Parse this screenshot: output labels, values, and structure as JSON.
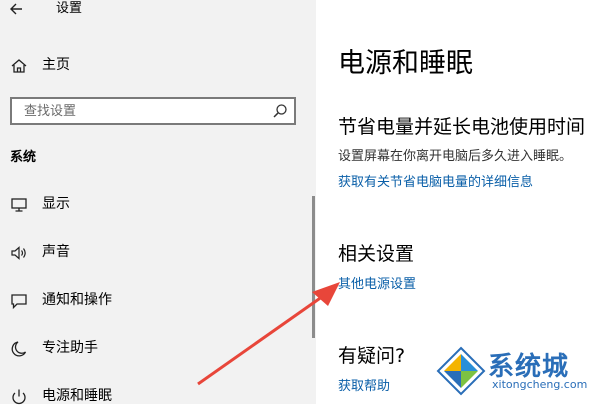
{
  "window": {
    "title": "设置"
  },
  "sidebar": {
    "home_label": "主页",
    "search_placeholder": "查找设置",
    "section_label": "系统",
    "items": [
      {
        "label": "显示",
        "icon": "monitor-icon"
      },
      {
        "label": "声音",
        "icon": "speaker-icon"
      },
      {
        "label": "通知和操作",
        "icon": "notification-icon"
      },
      {
        "label": "专注助手",
        "icon": "moon-icon"
      },
      {
        "label": "电源和睡眠",
        "icon": "power-icon"
      }
    ]
  },
  "main": {
    "title": "电源和睡眠",
    "battery_section": {
      "heading": "节省电量并延长电池使用时间",
      "description": "设置屏幕在你离开电脑后多久进入睡眠。",
      "link": "获取有关节省电脑电量的详细信息"
    },
    "related": {
      "heading": "相关设置",
      "link": "其他电源设置"
    },
    "help": {
      "heading": "有疑问?",
      "link": "获取帮助"
    }
  },
  "annotation": {
    "arrow_color": "#e8463a"
  },
  "watermark": {
    "text": "系统城",
    "url": "xitongcheng.com"
  }
}
